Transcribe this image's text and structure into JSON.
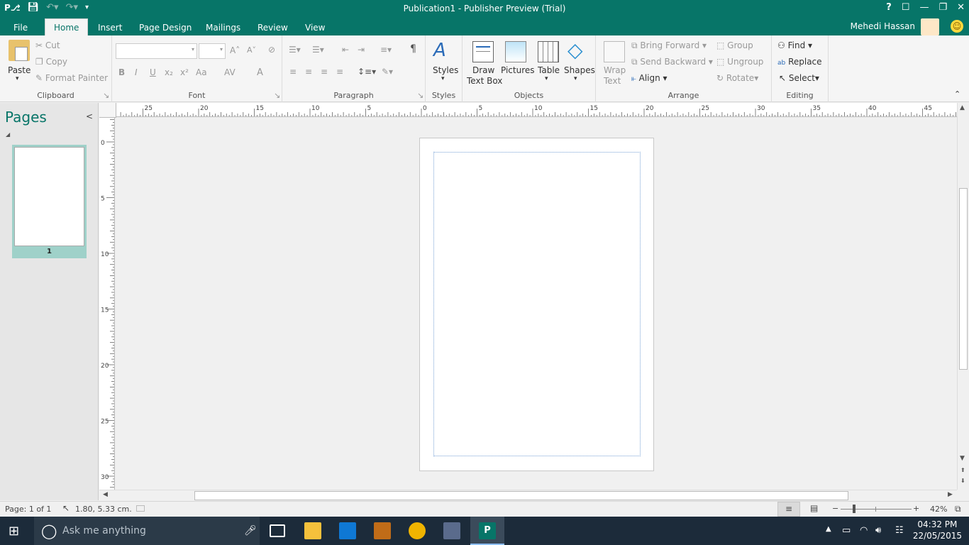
{
  "titlebar": {
    "title": "Publication1 - Publisher Preview (Trial)",
    "help": "?",
    "minimize": "—",
    "restore": "❐",
    "close": "✕",
    "ribbon_display": "☐"
  },
  "tabs": [
    {
      "label": "File"
    },
    {
      "label": "Home"
    },
    {
      "label": "Insert"
    },
    {
      "label": "Page Design"
    },
    {
      "label": "Mailings"
    },
    {
      "label": "Review"
    },
    {
      "label": "View"
    }
  ],
  "user": {
    "name": "Mehedi Hassan"
  },
  "ribbon": {
    "clipboard": {
      "label": "Clipboard",
      "paste": "Paste",
      "cut": "Cut",
      "copy": "Copy",
      "format_painter": "Format Painter"
    },
    "font": {
      "label": "Font",
      "bold": "B",
      "italic": "I",
      "underline": "U",
      "subscript": "x₂",
      "superscript": "x²",
      "change_case": "Aa",
      "spacing": "AV",
      "font_color": "A",
      "grow": "A˄",
      "shrink": "A˅"
    },
    "paragraph": {
      "label": "Paragraph",
      "pilcrow": "¶"
    },
    "styles": {
      "label": "Styles",
      "styles": "Styles"
    },
    "objects": {
      "label": "Objects",
      "draw_text_box_1": "Draw",
      "draw_text_box_2": "Text Box",
      "pictures": "Pictures",
      "table": "Table",
      "shapes": "Shapes"
    },
    "arrange": {
      "label": "Arrange",
      "wrap_text_1": "Wrap",
      "wrap_text_2": "Text",
      "bring_forward": "Bring Forward",
      "send_backward": "Send Backward",
      "align": "Align",
      "group": "Group",
      "ungroup": "Ungroup",
      "rotate": "Rotate"
    },
    "editing": {
      "label": "Editing",
      "find": "Find",
      "replace": "Replace",
      "select": "Select"
    }
  },
  "pages_panel": {
    "title": "Pages",
    "collapse": "<",
    "thumb_number": "1"
  },
  "ruler": {
    "h_labels": [
      "25",
      "20",
      "15",
      "10",
      "5",
      "0",
      "5",
      "10",
      "15",
      "20",
      "25",
      "30",
      "35",
      "40",
      "45"
    ],
    "v_labels": [
      "0",
      "5",
      "10",
      "15",
      "20",
      "25",
      "30"
    ]
  },
  "status": {
    "page": "Page: 1 of 1",
    "position": "1.80, 5.33 cm.",
    "zoom": "42%",
    "zoom_minus": "−",
    "zoom_plus": "+"
  },
  "taskbar": {
    "search_placeholder": "Ask me anything",
    "time": "04:32 PM",
    "date": "22/05/2015"
  },
  "colors": {
    "accent": "#077568",
    "taskbar": "#1c2b3a"
  }
}
